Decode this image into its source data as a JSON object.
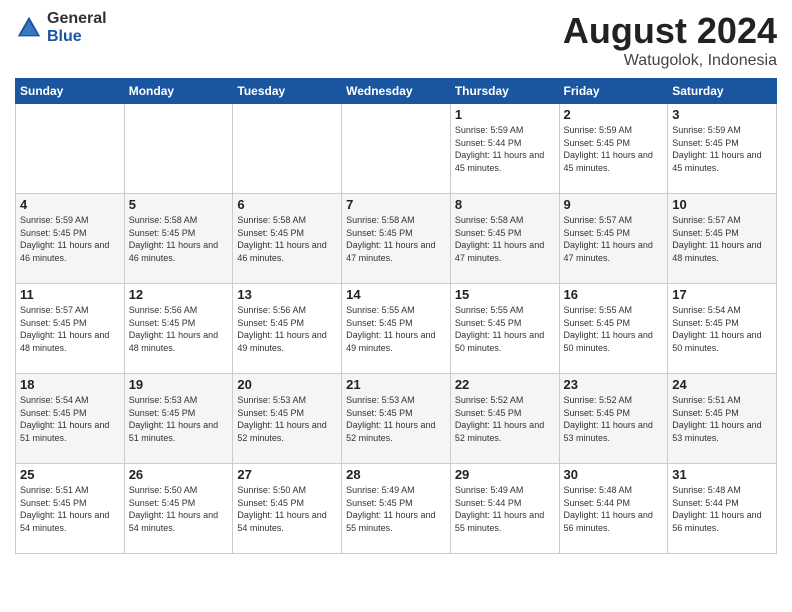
{
  "logo": {
    "general": "General",
    "blue": "Blue"
  },
  "title": "August 2024",
  "subtitle": "Watugolok, Indonesia",
  "days_of_week": [
    "Sunday",
    "Monday",
    "Tuesday",
    "Wednesday",
    "Thursday",
    "Friday",
    "Saturday"
  ],
  "weeks": [
    [
      {
        "day": "",
        "info": ""
      },
      {
        "day": "",
        "info": ""
      },
      {
        "day": "",
        "info": ""
      },
      {
        "day": "",
        "info": ""
      },
      {
        "day": "1",
        "info": "Sunrise: 5:59 AM\nSunset: 5:44 PM\nDaylight: 11 hours and 45 minutes."
      },
      {
        "day": "2",
        "info": "Sunrise: 5:59 AM\nSunset: 5:45 PM\nDaylight: 11 hours and 45 minutes."
      },
      {
        "day": "3",
        "info": "Sunrise: 5:59 AM\nSunset: 5:45 PM\nDaylight: 11 hours and 45 minutes."
      }
    ],
    [
      {
        "day": "4",
        "info": "Sunrise: 5:59 AM\nSunset: 5:45 PM\nDaylight: 11 hours and 46 minutes."
      },
      {
        "day": "5",
        "info": "Sunrise: 5:58 AM\nSunset: 5:45 PM\nDaylight: 11 hours and 46 minutes."
      },
      {
        "day": "6",
        "info": "Sunrise: 5:58 AM\nSunset: 5:45 PM\nDaylight: 11 hours and 46 minutes."
      },
      {
        "day": "7",
        "info": "Sunrise: 5:58 AM\nSunset: 5:45 PM\nDaylight: 11 hours and 47 minutes."
      },
      {
        "day": "8",
        "info": "Sunrise: 5:58 AM\nSunset: 5:45 PM\nDaylight: 11 hours and 47 minutes."
      },
      {
        "day": "9",
        "info": "Sunrise: 5:57 AM\nSunset: 5:45 PM\nDaylight: 11 hours and 47 minutes."
      },
      {
        "day": "10",
        "info": "Sunrise: 5:57 AM\nSunset: 5:45 PM\nDaylight: 11 hours and 48 minutes."
      }
    ],
    [
      {
        "day": "11",
        "info": "Sunrise: 5:57 AM\nSunset: 5:45 PM\nDaylight: 11 hours and 48 minutes."
      },
      {
        "day": "12",
        "info": "Sunrise: 5:56 AM\nSunset: 5:45 PM\nDaylight: 11 hours and 48 minutes."
      },
      {
        "day": "13",
        "info": "Sunrise: 5:56 AM\nSunset: 5:45 PM\nDaylight: 11 hours and 49 minutes."
      },
      {
        "day": "14",
        "info": "Sunrise: 5:55 AM\nSunset: 5:45 PM\nDaylight: 11 hours and 49 minutes."
      },
      {
        "day": "15",
        "info": "Sunrise: 5:55 AM\nSunset: 5:45 PM\nDaylight: 11 hours and 50 minutes."
      },
      {
        "day": "16",
        "info": "Sunrise: 5:55 AM\nSunset: 5:45 PM\nDaylight: 11 hours and 50 minutes."
      },
      {
        "day": "17",
        "info": "Sunrise: 5:54 AM\nSunset: 5:45 PM\nDaylight: 11 hours and 50 minutes."
      }
    ],
    [
      {
        "day": "18",
        "info": "Sunrise: 5:54 AM\nSunset: 5:45 PM\nDaylight: 11 hours and 51 minutes."
      },
      {
        "day": "19",
        "info": "Sunrise: 5:53 AM\nSunset: 5:45 PM\nDaylight: 11 hours and 51 minutes."
      },
      {
        "day": "20",
        "info": "Sunrise: 5:53 AM\nSunset: 5:45 PM\nDaylight: 11 hours and 52 minutes."
      },
      {
        "day": "21",
        "info": "Sunrise: 5:53 AM\nSunset: 5:45 PM\nDaylight: 11 hours and 52 minutes."
      },
      {
        "day": "22",
        "info": "Sunrise: 5:52 AM\nSunset: 5:45 PM\nDaylight: 11 hours and 52 minutes."
      },
      {
        "day": "23",
        "info": "Sunrise: 5:52 AM\nSunset: 5:45 PM\nDaylight: 11 hours and 53 minutes."
      },
      {
        "day": "24",
        "info": "Sunrise: 5:51 AM\nSunset: 5:45 PM\nDaylight: 11 hours and 53 minutes."
      }
    ],
    [
      {
        "day": "25",
        "info": "Sunrise: 5:51 AM\nSunset: 5:45 PM\nDaylight: 11 hours and 54 minutes."
      },
      {
        "day": "26",
        "info": "Sunrise: 5:50 AM\nSunset: 5:45 PM\nDaylight: 11 hours and 54 minutes."
      },
      {
        "day": "27",
        "info": "Sunrise: 5:50 AM\nSunset: 5:45 PM\nDaylight: 11 hours and 54 minutes."
      },
      {
        "day": "28",
        "info": "Sunrise: 5:49 AM\nSunset: 5:45 PM\nDaylight: 11 hours and 55 minutes."
      },
      {
        "day": "29",
        "info": "Sunrise: 5:49 AM\nSunset: 5:44 PM\nDaylight: 11 hours and 55 minutes."
      },
      {
        "day": "30",
        "info": "Sunrise: 5:48 AM\nSunset: 5:44 PM\nDaylight: 11 hours and 56 minutes."
      },
      {
        "day": "31",
        "info": "Sunrise: 5:48 AM\nSunset: 5:44 PM\nDaylight: 11 hours and 56 minutes."
      }
    ]
  ]
}
